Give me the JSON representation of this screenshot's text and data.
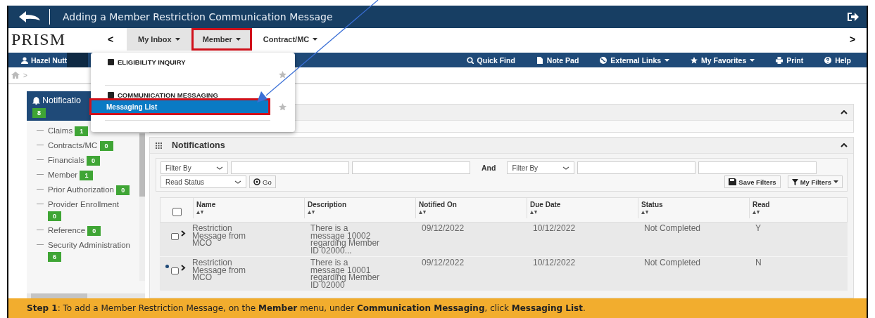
{
  "title_bar": {
    "title": "Adding a Member Restriction Communication Message"
  },
  "nav": {
    "logo": "PRISM",
    "prev": "<",
    "next": ">",
    "tabs": [
      {
        "label": "My Inbox",
        "shaded": true,
        "callout": false
      },
      {
        "label": "Member",
        "shaded": true,
        "callout": true
      },
      {
        "label": "Contract/MC",
        "shaded": false,
        "callout": false
      }
    ]
  },
  "user_bar": {
    "user": "Hazel Nutt",
    "links": [
      {
        "label": "Quick Find",
        "kind": "search",
        "dropdown": false
      },
      {
        "label": "Note Pad",
        "kind": "file",
        "dropdown": false
      },
      {
        "label": "External Links",
        "kind": "globe",
        "dropdown": true
      },
      {
        "label": "My Favorites",
        "kind": "star",
        "dropdown": true
      },
      {
        "label": "Print",
        "kind": "print",
        "dropdown": false
      },
      {
        "label": "Help",
        "kind": "help",
        "dropdown": false
      }
    ]
  },
  "breadcrumb": {
    "separator": ">"
  },
  "menu": {
    "sections": [
      {
        "heading": "ELIGIBILITY INQUIRY"
      },
      {
        "heading": "COMMUNICATION MESSAGING",
        "items": [
          {
            "label": "Messaging List",
            "selected": true,
            "callout": true
          }
        ]
      }
    ]
  },
  "sidebar": {
    "title": "Notificatio",
    "count": "8",
    "items": [
      {
        "label": "Claims",
        "count": "1"
      },
      {
        "label": "Contracts/MC",
        "count": "0"
      },
      {
        "label": "Financials",
        "count": "0"
      },
      {
        "label": "Member",
        "count": "1"
      },
      {
        "label": "Prior Authorization",
        "count": "0"
      },
      {
        "label": "Provider Enrollment",
        "count": "0"
      },
      {
        "label": "Reference",
        "count": "0"
      },
      {
        "label": "Security Administration",
        "count": "6"
      }
    ]
  },
  "notifications": {
    "title": "Notifications",
    "filters": {
      "filter_left": "Filter By",
      "conjunction": "And",
      "filter_right": "Filter By",
      "read_status": "Read Status",
      "go": "Go",
      "save": "Save Filters",
      "my_filters": "My Filters"
    },
    "select_all_checked": false,
    "columns": [
      "Name",
      "Description",
      "Notified On",
      "Due Date",
      "Status",
      "Read"
    ],
    "rows": [
      {
        "unread": false,
        "checked": false,
        "name": [
          "Restriction",
          "Message from",
          "MCO"
        ],
        "description": [
          "There is a",
          "message 10002",
          "regarding Member",
          "ID 02000..."
        ],
        "notified_on": "09/12/2022",
        "due_date": "10/12/2022",
        "status": "Not Completed",
        "read": "Y"
      },
      {
        "unread": true,
        "checked": false,
        "name": [
          "Restriction",
          "Message from",
          "MCO"
        ],
        "description": [
          "There is a",
          "message 10001",
          "regarding Member",
          "ID 02000"
        ],
        "notified_on": "09/12/2022",
        "due_date": "10/12/2022",
        "status": "Not Completed",
        "read": "N"
      }
    ]
  },
  "footer": {
    "text": "**Step 1**: To add a Member Restriction Message, on the **Member** menu, under **Communication Messaging**, click **Messaging List**."
  }
}
